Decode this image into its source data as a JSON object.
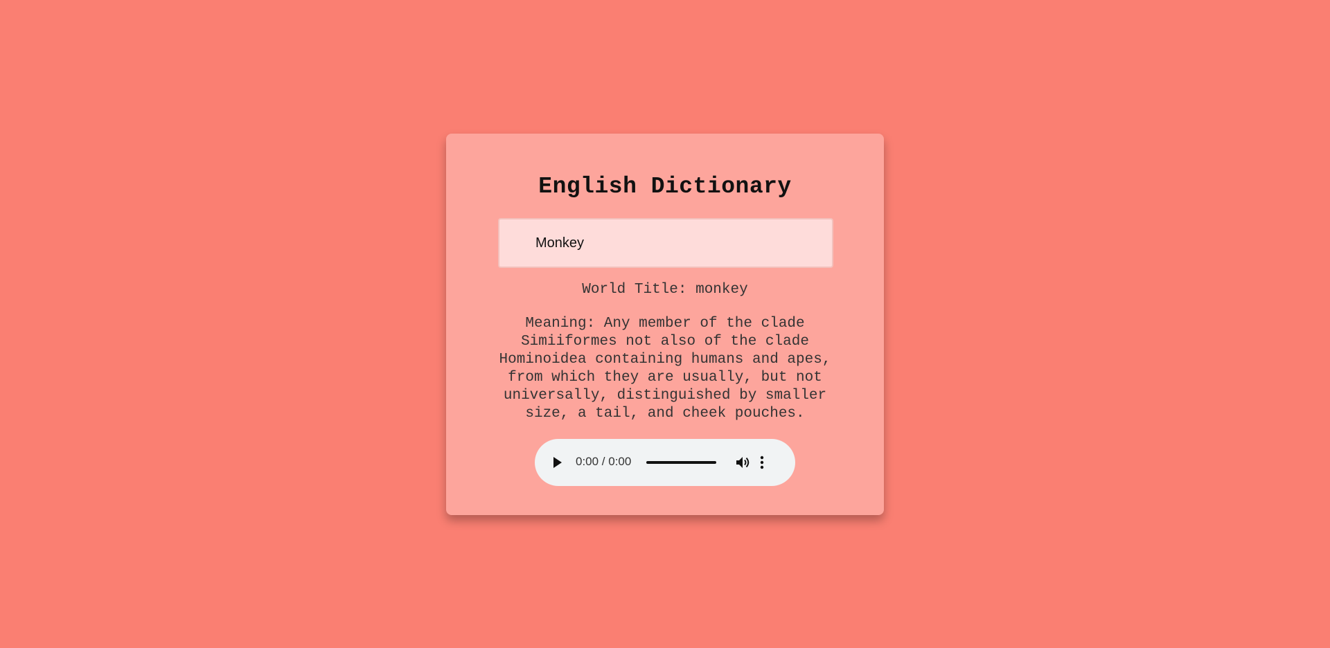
{
  "app": {
    "title": "English Dictionary"
  },
  "search": {
    "value": "Monkey"
  },
  "result": {
    "word_title": "World Title: monkey",
    "meaning": "Meaning: Any member of the clade Simiiformes not also of the clade Hominoidea containing humans and apes, from which they are usually, but not universally, distinguished by smaller size, a tail, and cheek pouches."
  },
  "audio": {
    "time": "0:00 / 0:00",
    "icons": [
      "play-icon",
      "volume-icon",
      "more-options-icon"
    ]
  },
  "colors": {
    "background": "#fa7f72",
    "card": "#fda59c",
    "input": "#fedcda",
    "player": "#f1f3f4"
  }
}
